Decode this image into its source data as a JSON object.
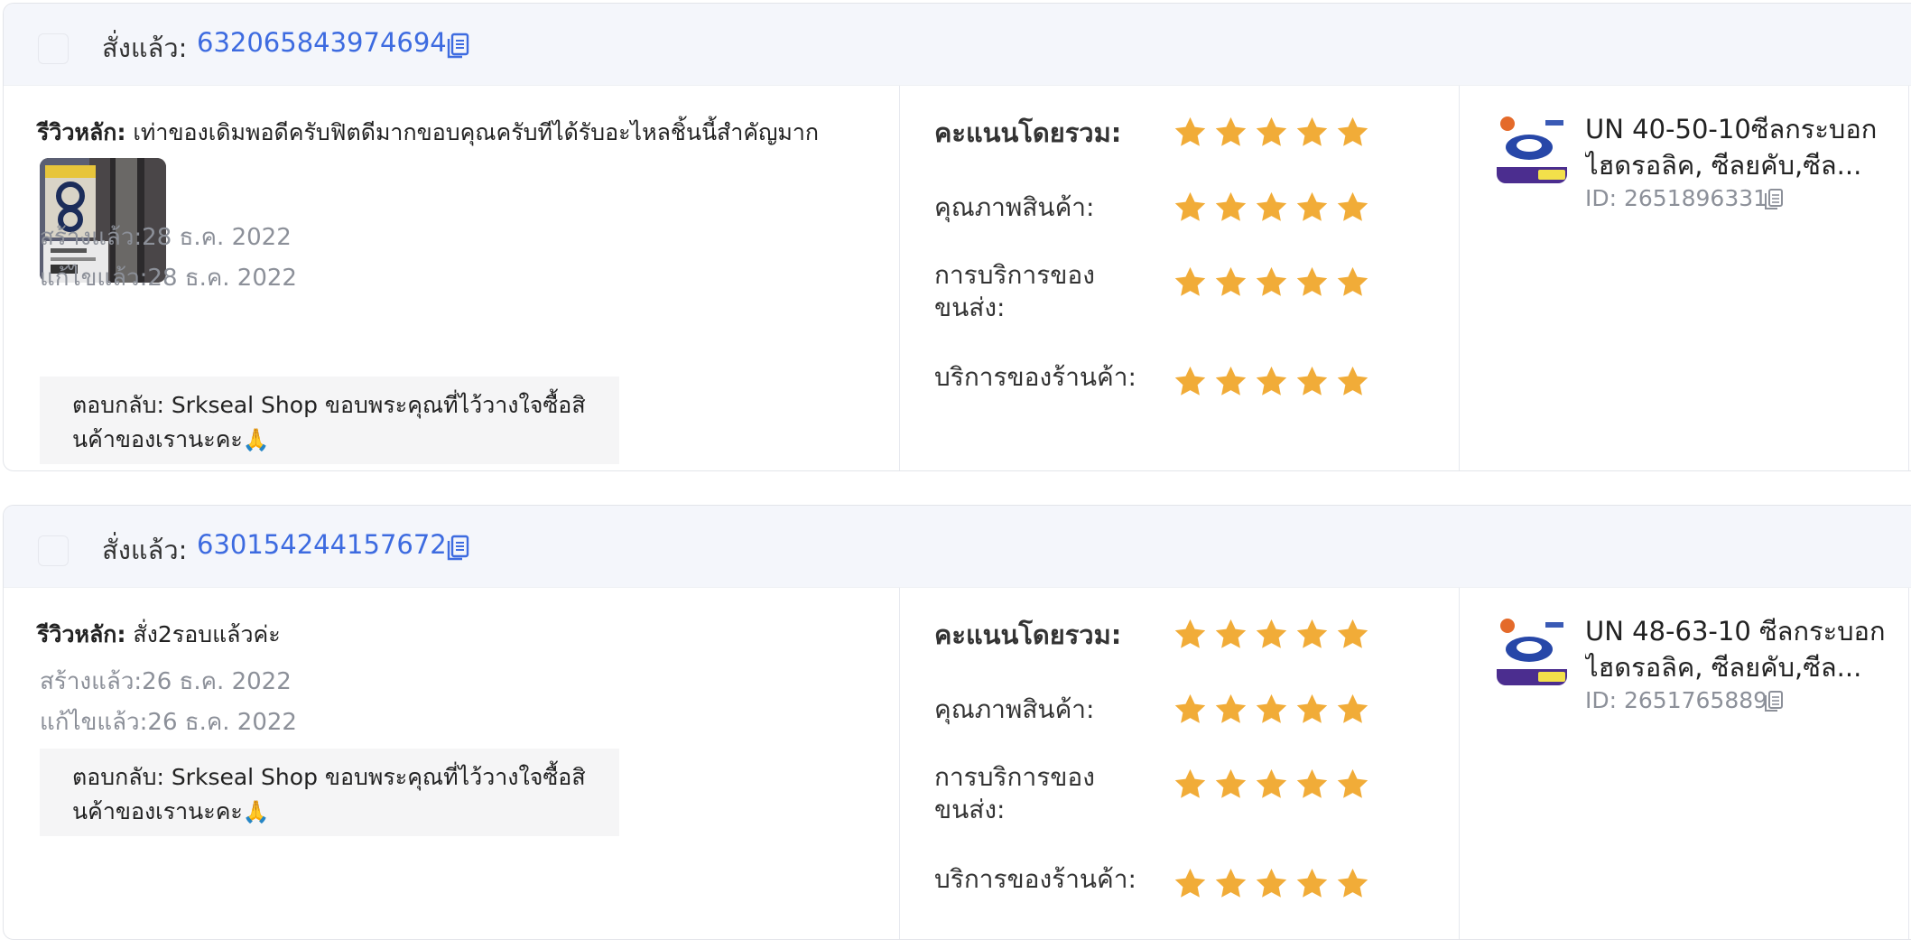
{
  "colors": {
    "accent": "#3d6be0",
    "star": "#f1ac38",
    "muted": "#8c9099"
  },
  "orders": [
    {
      "order_label": "สั่งแล้ว:",
      "order_id": "632065843974694",
      "review_label": "รีวิวหลัก:",
      "review_text": "เท่าของเดิมพอดีครับฟิตดีมากขอบคุณครับทีได้รับอะไหลชิ้นนี้สำคัญมาก",
      "created": "สร้างแล้ว:28 ธ.ค. 2022",
      "edited": "แก้ไขแล้ว:28 ธ.ค. 2022",
      "reply_line1": "ตอบกลับ: Srkseal Shop ขอบพระคุณที่ไว้วางใจซื้อสิ",
      "reply_line2": "นค้าของเรานะคะ",
      "reply_emoji": "🙏",
      "ratings": {
        "overall_label": "คะแนนโดยรวม:",
        "quality_label": "คุณภาพสินค้า:",
        "shipping_label_1": "การบริการของ",
        "shipping_label_2": "ขนส่ง:",
        "shop_label": "บริการของร้านค้า:",
        "overall": 5,
        "quality": 5,
        "shipping": 5,
        "shop": 5
      },
      "product": {
        "title_line1": "UN 40-50-10ซีลกระบอก",
        "title_line2": "ไฮดรอลิค, ซีลยคับ,ซีล...",
        "id_text": "ID: 2651896331"
      }
    },
    {
      "order_label": "สั่งแล้ว:",
      "order_id": "630154244157672",
      "review_label": "รีวิวหลัก:",
      "review_text": "สั่ง2รอบแล้วค่ะ",
      "created": "สร้างแล้ว:26 ธ.ค. 2022",
      "edited": "แก้ไขแล้ว:26 ธ.ค. 2022",
      "reply_line1": "ตอบกลับ: Srkseal Shop ขอบพระคุณที่ไว้วางใจซื้อสิ",
      "reply_line2": "นค้าของเรานะคะ",
      "reply_emoji": "🙏",
      "ratings": {
        "overall_label": "คะแนนโดยรวม:",
        "quality_label": "คุณภาพสินค้า:",
        "shipping_label_1": "การบริการของ",
        "shipping_label_2": "ขนส่ง:",
        "shop_label": "บริการของร้านค้า:",
        "overall": 5,
        "quality": 5,
        "shipping": 5,
        "shop": 5
      },
      "product": {
        "title_line1": "UN 48-63-10 ซีลกระบอก",
        "title_line2": "ไฮดรอลิค, ซีลยคับ,ซีล...",
        "id_text": "ID: 2651765889"
      }
    }
  ]
}
